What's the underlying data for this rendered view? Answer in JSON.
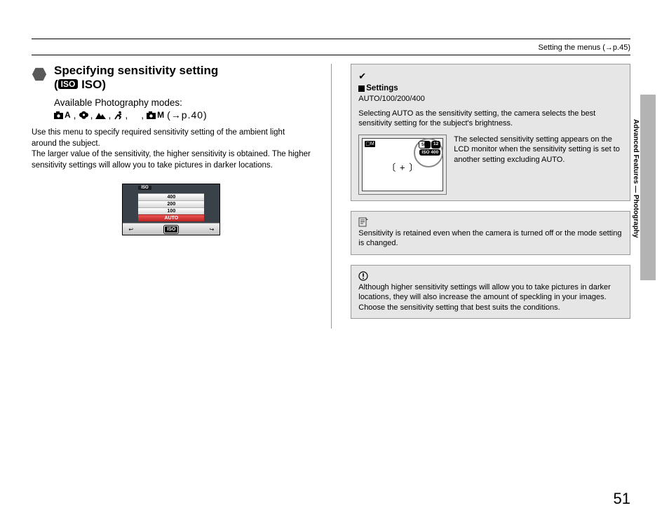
{
  "header": "Setting the menus (→p.45)",
  "title": "Specifying sensitivity setting",
  "title_iso_text": "ISO)",
  "subheading": "Available Photography modes:",
  "mode_ref": "(→p.40)",
  "body": "Use this menu to specify required sensitivity setting of the ambient light around the subject.\nThe larger value of the sensitivity, the higher sensitivity is obtained. The higher sensitivity settings will allow you to take pictures in darker locations.",
  "lcd_menu": {
    "label": "ISO",
    "items": [
      "400",
      "200",
      "100",
      "AUTO"
    ],
    "selected": "AUTO"
  },
  "settings_block": {
    "heading": "Settings",
    "values": "AUTO/100/200/400",
    "text1": "Selecting AUTO as the sensitivity setting, the camera selects the best sensitivity setting for the subject's brightness.",
    "text2": "The selected sensitivity setting appears on the LCD monitor when the sensitivity setting is set to another setting excluding AUTO.",
    "lcd_badge_num": "12",
    "lcd_badge_iso": "ISO  400"
  },
  "memo_note": "Sensitivity is retained even when the camera is turned off or the mode setting is changed.",
  "caution_note": "Although higher sensitivity settings will allow you to take pictures in darker locations, they will also increase the amount of speckling in your images. Choose the sensitivity setting that best suits the conditions.",
  "side_label": "Advanced Features — Photography",
  "page_number": "51",
  "mode_icon_a": "A",
  "mode_icon_m": "M"
}
